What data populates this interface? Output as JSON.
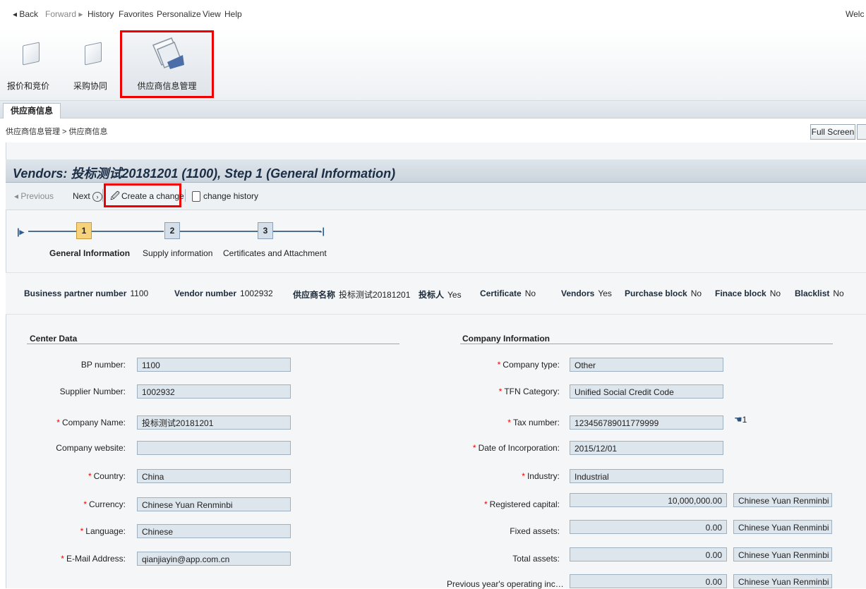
{
  "menu": {
    "back": "◂ Back",
    "forward": "Forward ▸",
    "history": "History",
    "favorites": "Favorites",
    "personalize": "Personalize",
    "view": "View",
    "help": "Help",
    "welcome": "Welc"
  },
  "apps": [
    {
      "label": "报价和竞价"
    },
    {
      "label": "采购协同"
    },
    {
      "label": "供应商信息管理"
    }
  ],
  "tab": {
    "label": "供应商信息"
  },
  "breadcrumb": "供应商信息管理 > 供应商信息",
  "fullscreen": "Full Screen",
  "title": "Vendors: 投标测试20181201 (1100), Step 1 (General Information)",
  "toolbar": {
    "previous": "◂ Previous",
    "next": "Next",
    "create_change": "Create a change",
    "change_history": "change history"
  },
  "roadmap": [
    {
      "num": "1",
      "label": "General Information"
    },
    {
      "num": "2",
      "label": "Supply information"
    },
    {
      "num": "3",
      "label": "Certificates and Attachment"
    }
  ],
  "info": [
    {
      "key": "Business partner number",
      "val": "1100"
    },
    {
      "key": "Vendor number",
      "val": "1002932"
    },
    {
      "key": "供应商名称",
      "val": "投标测试20181201"
    },
    {
      "key": "投标人",
      "val": "Yes"
    },
    {
      "key": "Certificate",
      "val": "No"
    },
    {
      "key": "Vendors",
      "val": "Yes"
    },
    {
      "key": "Purchase block",
      "val": "No"
    },
    {
      "key": "Finace block",
      "val": "No"
    },
    {
      "key": "Blacklist",
      "val": "No"
    }
  ],
  "center": {
    "title": "Center Data",
    "fields": [
      {
        "label": "BP number:",
        "value": "1100",
        "req": ""
      },
      {
        "label": "Supplier Number:",
        "value": "1002932",
        "req": ""
      },
      {
        "label": "Company Name:",
        "value": "投标测试20181201",
        "req": "*"
      },
      {
        "label": "Company website:",
        "value": "",
        "req": ""
      },
      {
        "label": "Country:",
        "value": "China",
        "req": "*"
      },
      {
        "label": "Currency:",
        "value": "Chinese Yuan Renminbi",
        "req": "*"
      },
      {
        "label": "Language:",
        "value": "Chinese",
        "req": "*"
      },
      {
        "label": "E-Mail Address:",
        "value": "qianjiayin@app.com.cn",
        "req": "*"
      }
    ]
  },
  "company": {
    "title": "Company Information",
    "fields": [
      {
        "label": "Company type:",
        "value": "Other",
        "req": "*"
      },
      {
        "label": "TFN Category:",
        "value": "Unified Social Credit Code",
        "req": "*"
      },
      {
        "label": "Tax number:",
        "value": "123456789011779999",
        "req": "*",
        "extra": "1"
      },
      {
        "label": "Date of Incorporation:",
        "value": "2015/12/01",
        "req": "*"
      },
      {
        "label": "Industry:",
        "value": "Industrial",
        "req": "*"
      },
      {
        "label": "Registered capital:",
        "value": "10,000,000.00",
        "req": "*",
        "currency": "Chinese Yuan Renminbi"
      },
      {
        "label": "Fixed assets:",
        "value": "0.00",
        "req": "",
        "currency": "Chinese Yuan Renminbi"
      },
      {
        "label": "Total assets:",
        "value": "0.00",
        "req": "",
        "currency": "Chinese Yuan Renminbi"
      },
      {
        "label": "Previous year's operating inc…",
        "value": "0.00",
        "req": "",
        "currency": "Chinese Yuan Renminbi"
      }
    ]
  }
}
